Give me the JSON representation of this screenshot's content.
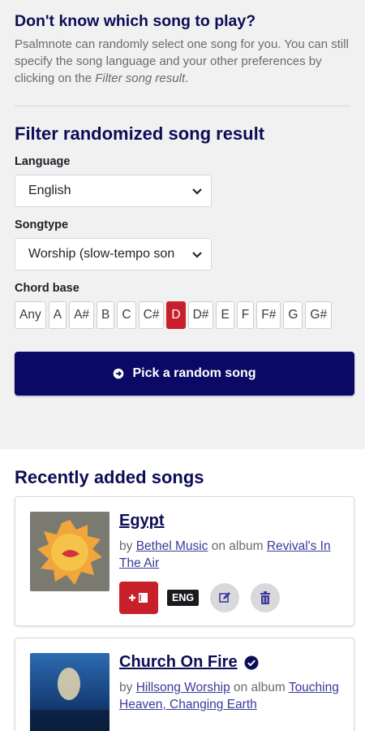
{
  "intro": {
    "title": "Don't know which song to play?",
    "text_main": "Psalmnote can randomly select one song for you. You can still specify the song language and your other preferences by clicking on the ",
    "text_link": "Filter song result",
    "text_end": "."
  },
  "filter": {
    "title": "Filter randomized song result",
    "language_label": "Language",
    "language_value": "English",
    "songtype_label": "Songtype",
    "songtype_value": "Worship (slow-tempo son",
    "chord_label": "Chord base",
    "chords": [
      "Any",
      "A",
      "A#",
      "B",
      "C",
      "C#",
      "D",
      "D#",
      "E",
      "F",
      "F#",
      "G",
      "G#"
    ],
    "selected_chord": "D"
  },
  "pick_button": {
    "label": "Pick a random song"
  },
  "recent": {
    "title": "Recently added songs",
    "songs": [
      {
        "title": "Egypt",
        "by": "by ",
        "artist": "Bethel Music",
        "on_album": " on album ",
        "album": "Revival's In The Air",
        "lang": "ENG",
        "verified": false
      },
      {
        "title": "Church On Fire",
        "by": "by ",
        "artist": "Hillsong Worship",
        "on_album": " on album ",
        "album": "Touching Heaven, Changing Earth",
        "verified": true
      }
    ]
  },
  "colors": {
    "accent": "#0a0a66",
    "danger": "#c8202b",
    "title": "#0d0d57"
  }
}
